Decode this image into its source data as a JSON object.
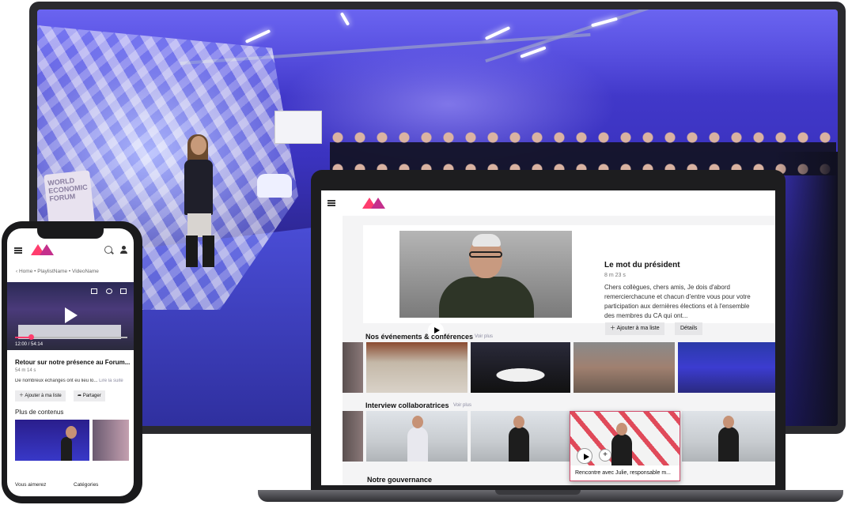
{
  "laptop": {
    "hero": {
      "title": "Le mot du président",
      "duration": "8 m 23 s",
      "description": "Chers collègues, chers amis, Je dois d'abord remercierchacune et chacun d'entre vous pour votre participation aux dernières élections et à l'ensemble des membres du CA qui ont...",
      "add_label": "Ajouter à ma liste",
      "details_label": "Détails"
    },
    "rows": [
      {
        "title": "Nos événements & conférences",
        "more": "Voir plus"
      },
      {
        "title": "Interview collaboratrices",
        "more": "Voir plus"
      },
      {
        "title": "Notre gouvernance",
        "more": ""
      }
    ],
    "featured_caption": "Rencontre avec Julie, responsable m..."
  },
  "phone": {
    "breadcrumb": "‹  Home • PlaylistName • VideoName",
    "player": {
      "time": "12:00 / 54:14",
      "progress": 0.14
    },
    "video_title": "Retour sur notre présence au Forum...",
    "duration": "54 m 14 s",
    "description": "De nombreux échanges ont eu lieu lo...",
    "read_more": "Lire la suite",
    "add_label": "Ajouter à ma liste",
    "share_label": "Partager",
    "more_section": "Plus de contenus",
    "tabs": {
      "liked": "Vous aimerez",
      "categories": "Catégories"
    }
  },
  "monitor": {
    "sign_text": "WORLD ECONOMIC FORUM"
  },
  "colors": {
    "brand_pink": "#ff3d6e",
    "brand_magenta": "#c42f8c",
    "stage_blue": "#3b33c0"
  }
}
